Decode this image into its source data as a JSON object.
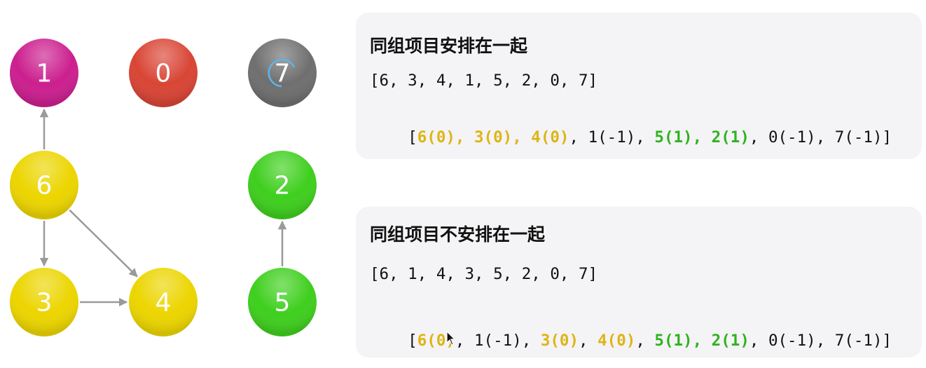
{
  "graph": {
    "nodes": [
      {
        "id": "1",
        "label": "1",
        "color": "#cc1f8f"
      },
      {
        "id": "0",
        "label": "0",
        "color": "#d94535"
      },
      {
        "id": "7",
        "label": "7",
        "color": "#6f6f6f"
      },
      {
        "id": "6",
        "label": "6",
        "color": "#ecd500"
      },
      {
        "id": "2",
        "label": "2",
        "color": "#3fcf1e"
      },
      {
        "id": "3",
        "label": "3",
        "color": "#ecd500"
      },
      {
        "id": "4",
        "label": "4",
        "color": "#ecd500"
      },
      {
        "id": "5",
        "label": "5",
        "color": "#3fcf1e"
      }
    ],
    "edges": [
      {
        "from": "6",
        "to": "1"
      },
      {
        "from": "6",
        "to": "3"
      },
      {
        "from": "6",
        "to": "4"
      },
      {
        "from": "3",
        "to": "4"
      },
      {
        "from": "5",
        "to": "2"
      }
    ]
  },
  "colors": {
    "group0": "#ddb515",
    "group1": "#2db31d",
    "panel_bg": "#f4f3f5",
    "edge": "#9a9a9a"
  },
  "panel_together": {
    "title": "同组项目安排在一起",
    "array": "[6, 3, 4, 1, 5, 2, 0, 7]",
    "grouped": [
      {
        "text": "[",
        "group": "none"
      },
      {
        "text": "6(0), 3(0), 4(0)",
        "group": "g0"
      },
      {
        "text": ", 1(-1), ",
        "group": "none"
      },
      {
        "text": "5(1), 2(1)",
        "group": "g1"
      },
      {
        "text": ", 0(-1), 7(-1)]",
        "group": "none"
      }
    ]
  },
  "panel_apart": {
    "title": "同组项目不安排在一起",
    "array": "[6, 1, 4, 3, 5, 2, 0, 7]",
    "grouped": [
      {
        "text": "[",
        "group": "none"
      },
      {
        "text": "6(0)",
        "group": "g0"
      },
      {
        "text": ", 1(-1), ",
        "group": "none"
      },
      {
        "text": "3(0)",
        "group": "g0"
      },
      {
        "text": ", ",
        "group": "none"
      },
      {
        "text": "4(0)",
        "group": "g0"
      },
      {
        "text": ", ",
        "group": "none"
      },
      {
        "text": "5(1), 2(1)",
        "group": "g1"
      },
      {
        "text": ", 0(-1), 7(-1)]",
        "group": "none"
      }
    ]
  }
}
